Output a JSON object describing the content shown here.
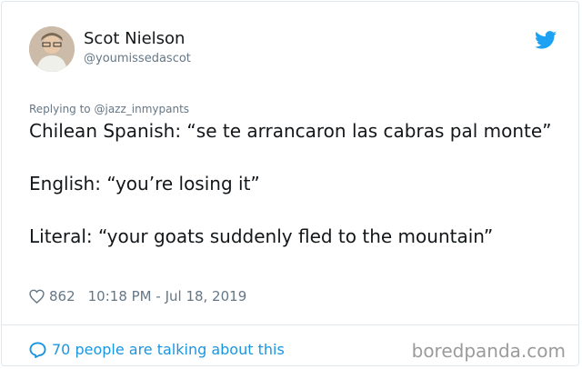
{
  "author": {
    "name": "Scot Nielson",
    "handle": "@youmissedascot",
    "avatar": "avatar-photo"
  },
  "reply": {
    "prefix": "Replying to",
    "mention": "@jazz_inmypants"
  },
  "tweet": {
    "line1": "Chilean Spanish: “se te arrancaron las cabras pal monte”",
    "line2": "English: “you’re losing it”",
    "line3": "Literal: “your goats suddenly fled to the mountain”"
  },
  "meta": {
    "likes": "862",
    "time": "10:18 PM - Jul 18, 2019"
  },
  "footer": {
    "talking": "70 people are talking about this",
    "watermark": "boredpanda.com"
  },
  "colors": {
    "twitter_blue": "#1da1f2",
    "link_blue": "#1b95e0",
    "secondary_text": "#657786"
  },
  "icons": [
    "twitter-bird-icon",
    "heart-icon",
    "comment-bubble-icon"
  ]
}
